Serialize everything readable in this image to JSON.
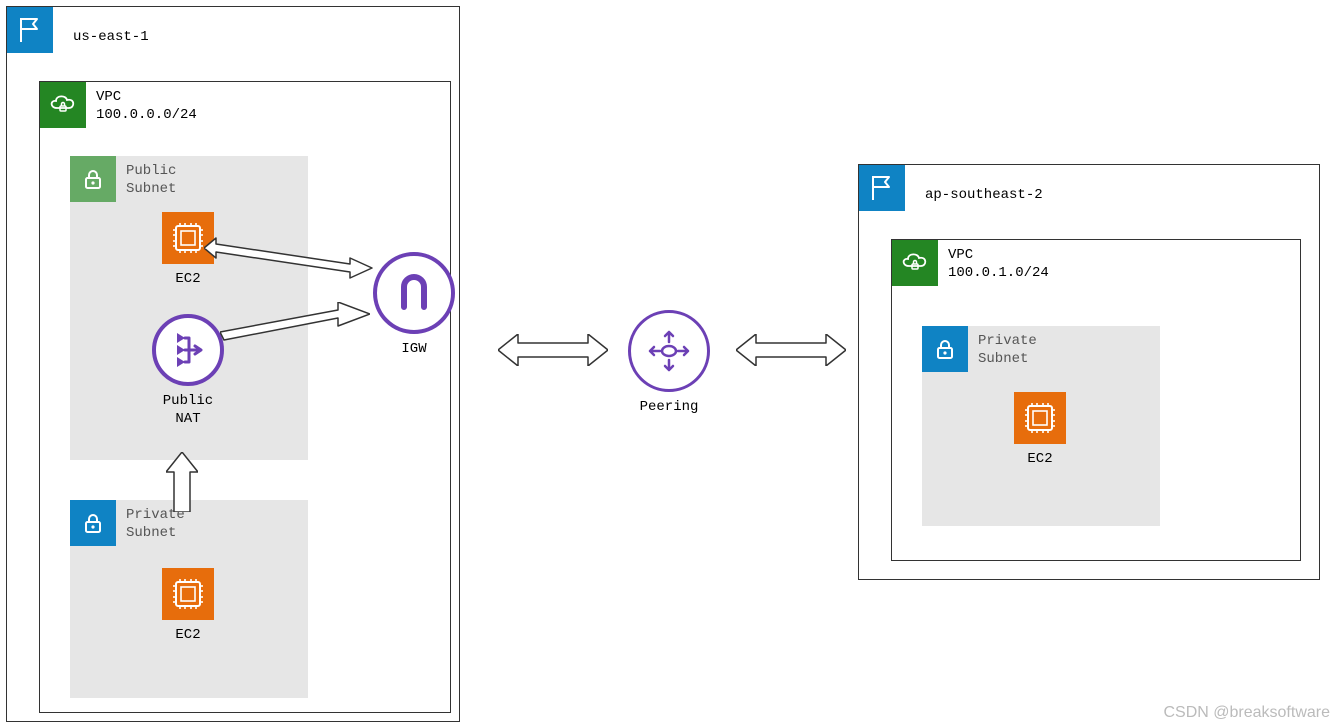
{
  "regions": {
    "left": {
      "label": "us-east-1"
    },
    "right": {
      "label": "ap-southeast-2"
    }
  },
  "vpcs": {
    "left": {
      "title": "VPC",
      "cidr": "100.0.0.0/24"
    },
    "right": {
      "title": "VPC",
      "cidr": "100.0.1.0/24"
    }
  },
  "subnets": {
    "left_public": {
      "line1": "Public",
      "line2": "Subnet"
    },
    "left_private": {
      "line1": "Private",
      "line2": "Subnet"
    },
    "right_private": {
      "line1": "Private",
      "line2": "Subnet"
    }
  },
  "nodes": {
    "ec2_left_public": {
      "label": "EC2"
    },
    "ec2_left_private": {
      "label": "EC2"
    },
    "ec2_right_private": {
      "label": "EC2"
    },
    "nat": {
      "line1": "Public",
      "line2": "NAT"
    },
    "igw": {
      "label": "IGW"
    },
    "peering": {
      "label": "Peering"
    }
  },
  "watermark": "CSDN @breaksoftware"
}
